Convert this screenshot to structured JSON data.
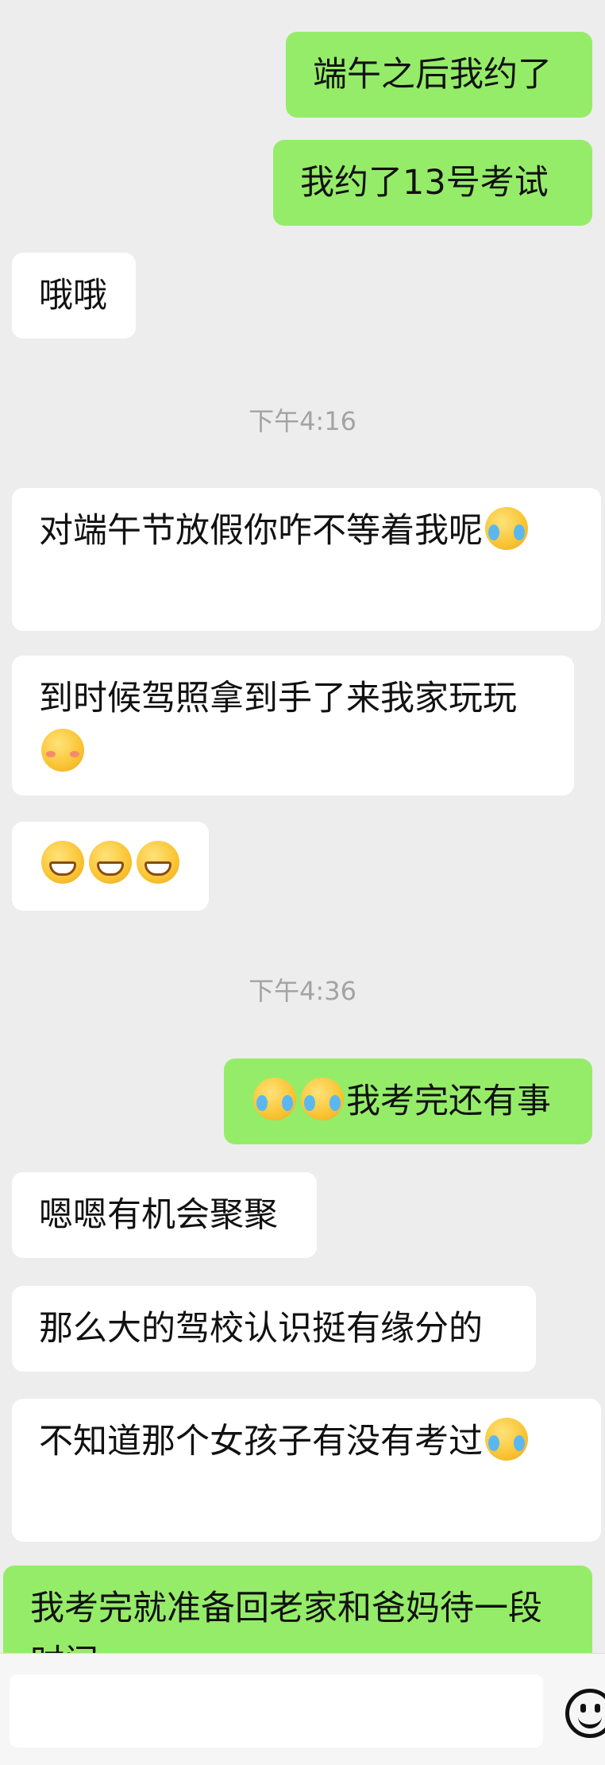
{
  "chat": {
    "top_partial_text": "··· ···",
    "messages": [
      {
        "side": "right",
        "text": "端午之后我约了"
      },
      {
        "side": "right",
        "text": "我约了13号考试"
      },
      {
        "side": "left",
        "text": "哦哦"
      },
      {
        "type": "time",
        "text": "下午4:16"
      },
      {
        "side": "left",
        "text": "对端午节放假你咋不等着我呢",
        "emoji": [
          "tears-of-joy"
        ]
      },
      {
        "side": "left",
        "text": "到时候驾照拿到手了来我家玩玩",
        "emoji": [
          "shy-smile"
        ]
      },
      {
        "side": "left",
        "emoji": [
          "grin",
          "grin",
          "grin"
        ]
      },
      {
        "type": "time",
        "text": "下午4:36"
      },
      {
        "side": "right",
        "text": "我考完还有事",
        "emoji": [
          "tears-of-joy",
          "tears-of-joy"
        ]
      },
      {
        "side": "left",
        "text": "嗯嗯有机会聚聚"
      },
      {
        "side": "left",
        "text": "那么大的驾校认识挺有缘分的"
      },
      {
        "side": "left",
        "text": "不知道那个女孩子有没有考过",
        "emoji": [
          "tears-of-joy"
        ]
      },
      {
        "side": "right",
        "text": "我考完就准备回老家和爸妈待一段时间"
      }
    ]
  },
  "input_bar": {
    "emoji_button_icon": "smiley-face-icon"
  }
}
